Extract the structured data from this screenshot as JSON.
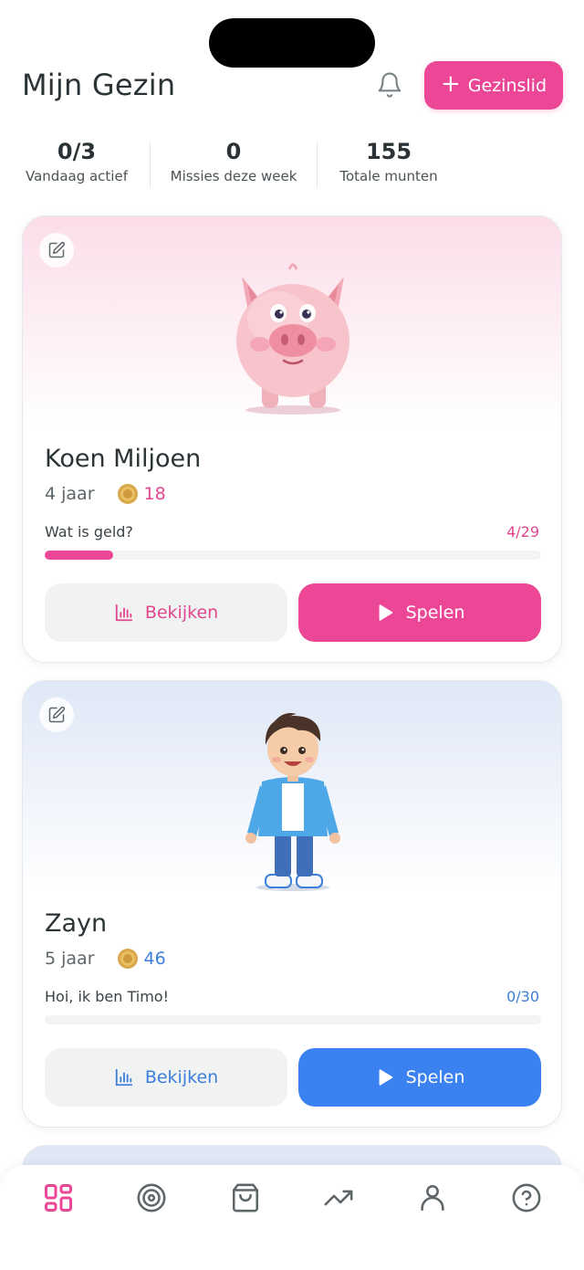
{
  "header": {
    "title": "Mijn Gezin",
    "add_label": "Gezinslid"
  },
  "stats": [
    {
      "value": "0/3",
      "label": "Vandaag actief"
    },
    {
      "value": "0",
      "label": "Missies deze week"
    },
    {
      "value": "155",
      "label": "Totale munten"
    }
  ],
  "members": [
    {
      "name": "Koen Miljoen",
      "age": "4 jaar",
      "coins": "18",
      "mission": "Wat is geld?",
      "progress_text": "4/29",
      "progress_value": 0.138,
      "accent": "#ec4696",
      "view_label": "Bekijken",
      "play_label": "Spelen",
      "avatar": "piggy-bank"
    },
    {
      "name": "Zayn",
      "age": "5 jaar",
      "coins": "46",
      "mission": "Hoi, ik ben Timo!",
      "progress_text": "0/30",
      "progress_value": 0,
      "accent": "#3b82f0",
      "view_label": "Bekijken",
      "play_label": "Spelen",
      "avatar": "boy-character"
    }
  ],
  "tabbar": {
    "items": [
      "dashboard-icon",
      "target-icon",
      "shop-bag-icon",
      "trending-up-icon",
      "profile-icon",
      "help-icon"
    ],
    "active": "dashboard-icon",
    "active_color": "#ec4696"
  }
}
